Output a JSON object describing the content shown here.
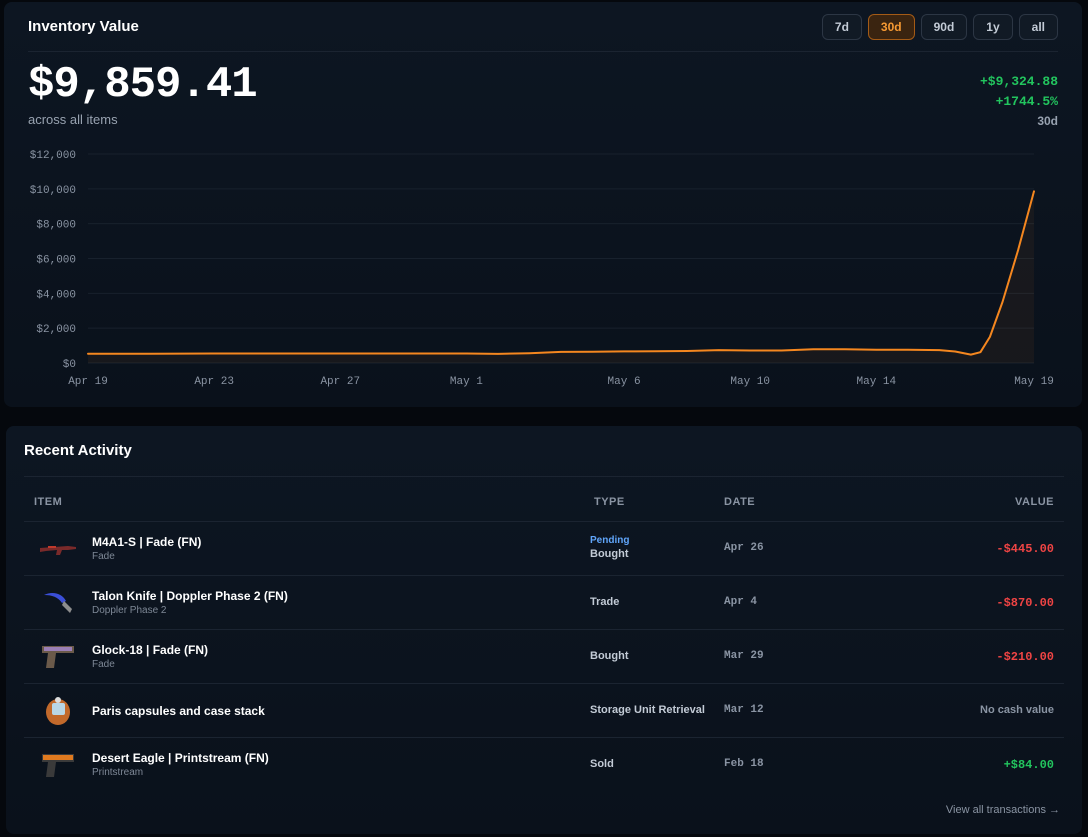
{
  "inventory": {
    "title": "Inventory Value",
    "ranges": [
      "7d",
      "30d",
      "90d",
      "1y",
      "all"
    ],
    "active_range": "30d",
    "total_value": "$9,859.41",
    "total_sub": "across all items",
    "delta_abs": "+$9,324.88",
    "delta_pct": "+1744.5%",
    "delta_range": "30d"
  },
  "colors": {
    "accent": "#f5871f",
    "positive": "#22c55e",
    "negative": "#ef4444",
    "pending": "#60a5fa"
  },
  "chart_data": {
    "type": "line",
    "title": "",
    "xlabel": "",
    "ylabel": "",
    "ylim": [
      0,
      12000
    ],
    "y_ticks": [
      "$12,000",
      "$10,000",
      "$8,000",
      "$6,000",
      "$4,000",
      "$2,000",
      "$0"
    ],
    "y_tick_values": [
      12000,
      10000,
      8000,
      6000,
      4000,
      2000,
      0
    ],
    "x_ticks": [
      "Apr 19",
      "Apr 23",
      "Apr 27",
      "May 1",
      "May 6",
      "May 10",
      "May 14",
      "May 19"
    ],
    "x_tick_days": [
      0,
      4,
      8,
      12,
      17,
      21,
      25,
      30
    ],
    "grid": true,
    "series": [
      {
        "color": "#f5871f",
        "x": [
          0,
          2,
          4,
          6,
          8,
          10,
          12,
          13,
          14,
          15,
          16,
          17,
          18,
          19,
          20,
          21,
          22,
          23,
          24,
          25,
          26,
          27,
          27.5,
          28,
          28.3,
          28.6,
          29,
          29.5,
          30
        ],
        "y": [
          535,
          530,
          545,
          545,
          545,
          545,
          545,
          520,
          560,
          640,
          650,
          665,
          670,
          690,
          740,
          720,
          720,
          790,
          790,
          760,
          760,
          740,
          660,
          480,
          620,
          1500,
          3500,
          6500,
          9859
        ]
      }
    ]
  },
  "activity": {
    "title": "Recent Activity",
    "headers": {
      "item": "ITEM",
      "type": "TYPE",
      "date": "DATE",
      "value": "VALUE"
    },
    "rows": [
      {
        "name": "M4A1-S | Fade (FN)",
        "sub": "Fade",
        "pending": "Pending",
        "type": "Bought",
        "date": "Apr 26",
        "value": "-$445.00",
        "kind": "neg",
        "icon": "rifle-icon"
      },
      {
        "name": "Talon Knife | Doppler Phase 2 (FN)",
        "sub": "Doppler Phase 2",
        "pending": "",
        "type": "Trade",
        "date": "Apr 4",
        "value": "-$870.00",
        "kind": "neg",
        "icon": "knife-icon"
      },
      {
        "name": "Glock-18 | Fade (FN)",
        "sub": "Fade",
        "pending": "",
        "type": "Bought",
        "date": "Mar 29",
        "value": "-$210.00",
        "kind": "neg",
        "icon": "pistol-icon"
      },
      {
        "name": "Paris capsules and case stack",
        "sub": "",
        "pending": "",
        "type": "Storage Unit Retrieval",
        "date": "Mar 12",
        "value": "No cash value",
        "kind": "none",
        "icon": "capsule-icon"
      },
      {
        "name": "Desert Eagle | Printstream (FN)",
        "sub": "Printstream",
        "pending": "",
        "type": "Sold",
        "date": "Feb 18",
        "value": "+$84.00",
        "kind": "pos",
        "icon": "deagle-icon"
      }
    ],
    "view_all": "View all transactions →"
  }
}
